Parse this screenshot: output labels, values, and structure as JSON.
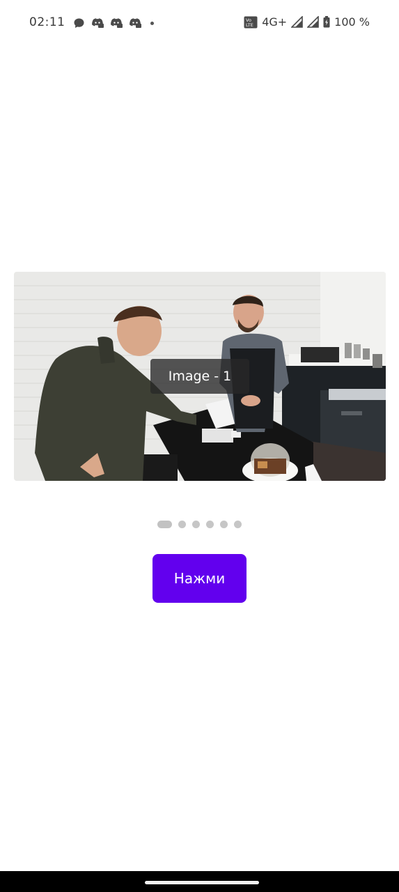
{
  "status_bar": {
    "time": "02:11",
    "network": "4G+",
    "volte": "Vo LTE",
    "battery": "100 %",
    "notification_icons": [
      "message-icon",
      "discord-icon",
      "discord-icon",
      "discord-icon"
    ]
  },
  "carousel": {
    "slide_label": "Image - 1",
    "page_count": 6,
    "active_index": 0
  },
  "button": {
    "label": "Нажми"
  },
  "colors": {
    "accent": "#6200ee",
    "dot": "#c6c6c6",
    "nav_bar": "#000000"
  }
}
